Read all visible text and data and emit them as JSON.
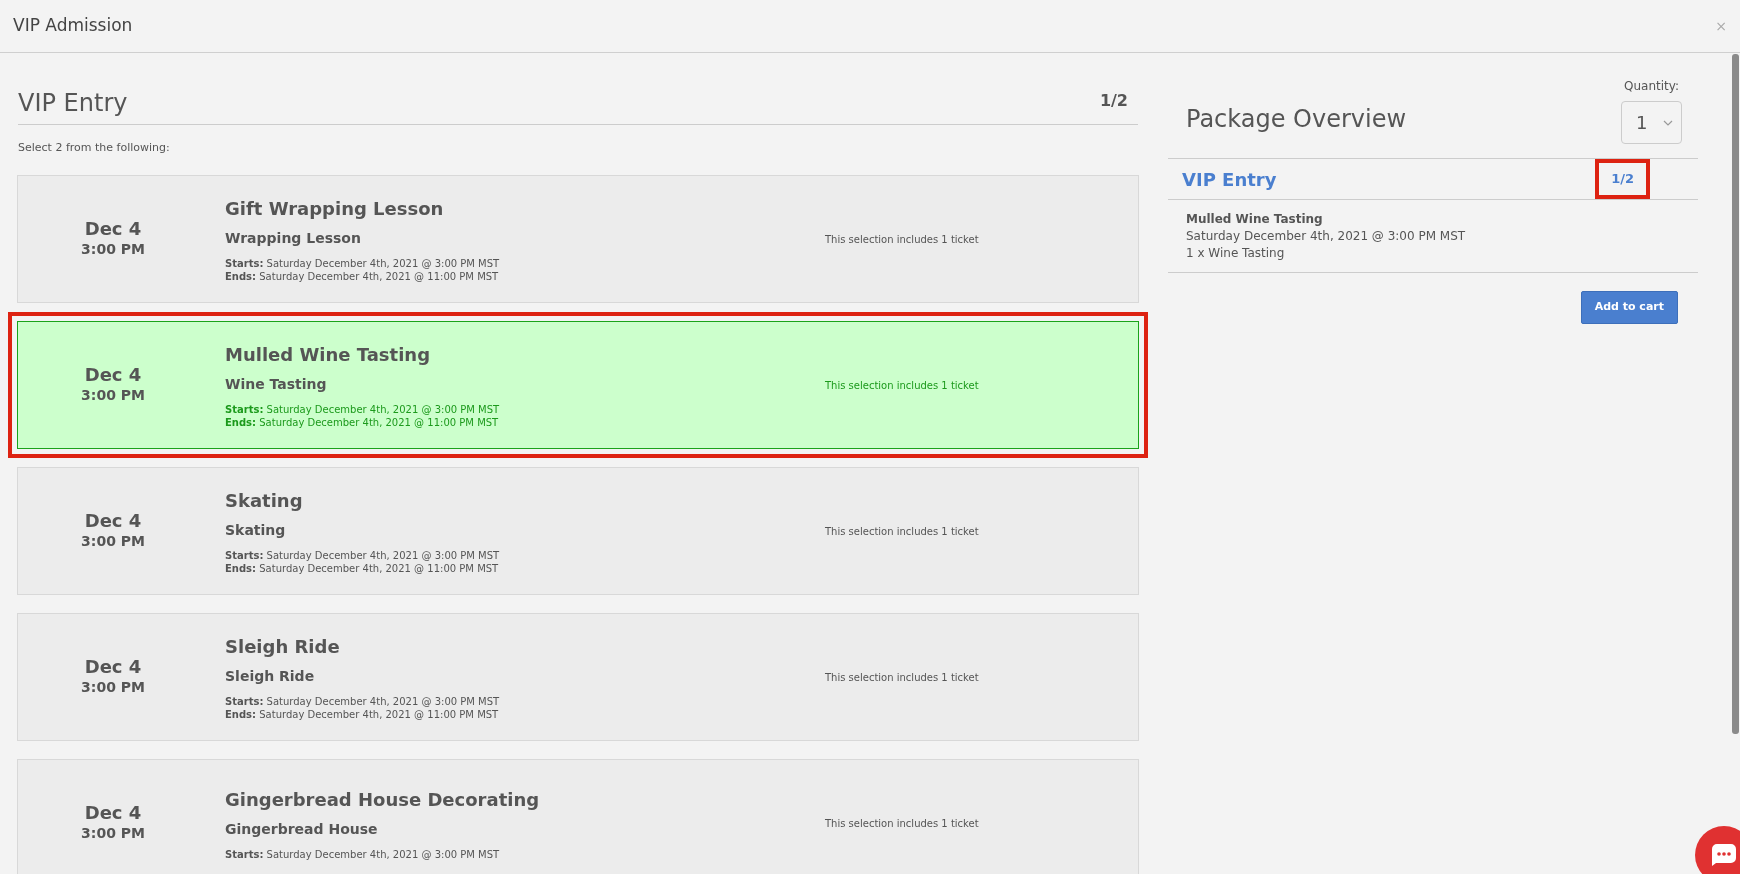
{
  "window": {
    "title": "VIP Admission",
    "close": "×"
  },
  "section": {
    "title": "VIP Entry",
    "counter": "1/2",
    "instruction": "Select 2 from the following:"
  },
  "options": [
    {
      "date": "Dec 4",
      "time": "3:00 PM",
      "title": "Gift Wrapping Lesson",
      "subtitle": "Wrapping Lesson",
      "starts_label": "Starts:",
      "starts": "Saturday December 4th, 2021 @ 3:00 PM MST",
      "ends_label": "Ends:",
      "ends": "Saturday December 4th, 2021 @ 11:00 PM MST",
      "note": "This selection includes 1 ticket",
      "selected": false,
      "highlighted": false
    },
    {
      "date": "Dec 4",
      "time": "3:00 PM",
      "title": "Mulled Wine Tasting",
      "subtitle": "Wine Tasting",
      "starts_label": "Starts:",
      "starts": "Saturday December 4th, 2021 @ 3:00 PM MST",
      "ends_label": "Ends:",
      "ends": "Saturday December 4th, 2021 @ 11:00 PM MST",
      "note": "This selection includes 1 ticket",
      "selected": true,
      "highlighted": true
    },
    {
      "date": "Dec 4",
      "time": "3:00 PM",
      "title": "Skating",
      "subtitle": "Skating",
      "starts_label": "Starts:",
      "starts": "Saturday December 4th, 2021 @ 3:00 PM MST",
      "ends_label": "Ends:",
      "ends": "Saturday December 4th, 2021 @ 11:00 PM MST",
      "note": "This selection includes 1 ticket",
      "selected": false,
      "highlighted": false
    },
    {
      "date": "Dec 4",
      "time": "3:00 PM",
      "title": "Sleigh Ride",
      "subtitle": "Sleigh Ride",
      "starts_label": "Starts:",
      "starts": "Saturday December 4th, 2021 @ 3:00 PM MST",
      "ends_label": "Ends:",
      "ends": "Saturday December 4th, 2021 @ 11:00 PM MST",
      "note": "This selection includes 1 ticket",
      "selected": false,
      "highlighted": false
    },
    {
      "date": "Dec 4",
      "time": "3:00 PM",
      "title": "Gingerbread House Decorating",
      "subtitle": "Gingerbread House",
      "starts_label": "Starts:",
      "starts": "Saturday December 4th, 2021 @ 3:00 PM MST",
      "note": "This selection includes 1 ticket",
      "selected": false,
      "highlighted": false
    }
  ],
  "overview": {
    "title": "Package Overview",
    "quantity_label": "Quantity:",
    "quantity": "1",
    "group_title": "VIP Entry",
    "group_counter": "1/2",
    "counter_highlighted": true,
    "items": [
      {
        "title": "Mulled Wine Tasting",
        "datetime": "Saturday December 4th, 2021 @ 3:00 PM MST",
        "detail": "1 x Wine Tasting"
      }
    ],
    "button": "Add to cart"
  }
}
